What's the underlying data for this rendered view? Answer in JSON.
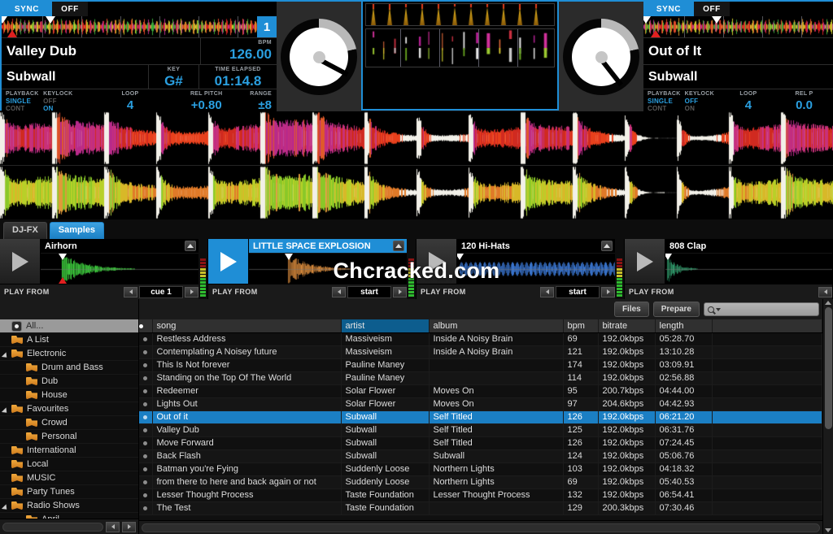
{
  "decks": [
    {
      "id": "deck-1",
      "number": "1",
      "sync_label": "SYNC",
      "off_label": "OFF",
      "title": "Valley Dub",
      "artist": "Subwall",
      "bpm_label": "BPM",
      "bpm_value": "126.00",
      "key_label": "KEY",
      "key_value": "G#",
      "time_label": "TIME ELAPSED",
      "time_value": "01:14.8",
      "playback_label": "PLAYBACK",
      "playback_single": "SINGLE",
      "playback_cont": "CONT",
      "playback_active": "single",
      "keylock_label": "KEYLOCK",
      "keylock_off": "OFF",
      "keylock_on": "ON",
      "keylock_active": "on",
      "loop_label": "LOOP",
      "loop_value": "4",
      "pitch_label": "REL PITCH",
      "pitch_value": "+0.80",
      "range_label": "RANGE",
      "range_value": "±8",
      "jog_angle_deg": 28
    },
    {
      "id": "deck-2",
      "number": "",
      "sync_label": "SYNC",
      "off_label": "OFF",
      "title": "Out of It",
      "artist": "Subwall",
      "bpm_label": "",
      "bpm_value": "",
      "key_label": "",
      "key_value": "",
      "time_label": "",
      "time_value": "",
      "playback_label": "PLAYBACK",
      "playback_single": "SINGLE",
      "playback_cont": "CONT",
      "playback_active": "single",
      "keylock_label": "KEYLOCK",
      "keylock_off": "OFF",
      "keylock_on": "ON",
      "keylock_active": "off",
      "loop_label": "LOOP",
      "loop_value": "4",
      "pitch_label": "REL P",
      "pitch_value": "0.0",
      "range_label": "",
      "range_value": "",
      "jog_angle_deg": 52
    }
  ],
  "fx": {
    "tabs": [
      {
        "label": "DJ-FX",
        "active": false
      },
      {
        "label": "Samples",
        "active": true
      }
    ]
  },
  "samples": [
    {
      "name": "Airhorn",
      "playing": false,
      "selected": false,
      "play_from_label": "PLAY FROM",
      "cue": "cue 1",
      "wave_color": "#3fd43f"
    },
    {
      "name": "LITTLE SPACE EXPLOSION",
      "playing": true,
      "selected": true,
      "play_from_label": "PLAY FROM",
      "cue": "start",
      "wave_color": "#d88a3c"
    },
    {
      "name": "120 Hi-Hats",
      "playing": false,
      "selected": false,
      "play_from_label": "PLAY FROM",
      "cue": "start",
      "wave_color": "#3c7ad8"
    },
    {
      "name": "808 Clap",
      "playing": false,
      "selected": false,
      "play_from_label": "PLAY FROM",
      "cue": "",
      "wave_color": "#2f9a6a"
    }
  ],
  "sidebar": {
    "items": [
      {
        "label": "All...",
        "icon": "all-icon",
        "level": 0,
        "selected": true,
        "expandable": false,
        "expanded": false
      },
      {
        "label": "A List",
        "icon": "folder-icon",
        "level": 0,
        "selected": false,
        "expandable": false,
        "expanded": false
      },
      {
        "label": "Electronic",
        "icon": "folder-icon",
        "level": 0,
        "selected": false,
        "expandable": true,
        "expanded": true
      },
      {
        "label": "Drum and Bass",
        "icon": "folder-icon",
        "level": 1,
        "selected": false,
        "expandable": false,
        "expanded": false
      },
      {
        "label": "Dub",
        "icon": "folder-icon",
        "level": 1,
        "selected": false,
        "expandable": false,
        "expanded": false
      },
      {
        "label": "House",
        "icon": "folder-icon",
        "level": 1,
        "selected": false,
        "expandable": false,
        "expanded": false
      },
      {
        "label": "Favourites",
        "icon": "folder-icon",
        "level": 0,
        "selected": false,
        "expandable": true,
        "expanded": true
      },
      {
        "label": "Crowd",
        "icon": "folder-icon",
        "level": 1,
        "selected": false,
        "expandable": false,
        "expanded": false
      },
      {
        "label": "Personal",
        "icon": "folder-icon",
        "level": 1,
        "selected": false,
        "expandable": false,
        "expanded": false
      },
      {
        "label": "International",
        "icon": "folder-icon",
        "level": 0,
        "selected": false,
        "expandable": false,
        "expanded": false
      },
      {
        "label": "Local",
        "icon": "folder-icon",
        "level": 0,
        "selected": false,
        "expandable": false,
        "expanded": false
      },
      {
        "label": "MUSIC",
        "icon": "folder-icon",
        "level": 0,
        "selected": false,
        "expandable": false,
        "expanded": false
      },
      {
        "label": "Party Tunes",
        "icon": "folder-icon",
        "level": 0,
        "selected": false,
        "expandable": false,
        "expanded": false
      },
      {
        "label": "Radio Shows",
        "icon": "folder-icon",
        "level": 0,
        "selected": false,
        "expandable": true,
        "expanded": true
      },
      {
        "label": "April",
        "icon": "folder-icon",
        "level": 1,
        "selected": false,
        "expandable": false,
        "expanded": false
      }
    ]
  },
  "toolbar": {
    "files_label": "Files",
    "prepare_label": "Prepare",
    "search_value": "",
    "search_placeholder": ""
  },
  "table": {
    "columns": [
      {
        "key": "song",
        "label": "song",
        "sorted": false
      },
      {
        "key": "artist",
        "label": "artist",
        "sorted": true
      },
      {
        "key": "album",
        "label": "album",
        "sorted": false
      },
      {
        "key": "bpm",
        "label": "bpm",
        "sorted": false
      },
      {
        "key": "bitrate",
        "label": "bitrate",
        "sorted": false
      },
      {
        "key": "length",
        "label": "length",
        "sorted": false
      }
    ],
    "rows": [
      {
        "song": "Restless Address",
        "artist": "Massiveism",
        "album": "Inside A Noisy Brain",
        "bpm": "69",
        "bitrate": "192.0kbps",
        "length": "05:28.70",
        "selected": false
      },
      {
        "song": "Contemplating A Noisey future",
        "artist": "Massiveism",
        "album": "Inside A Noisy Brain",
        "bpm": "121",
        "bitrate": "192.0kbps",
        "length": "13:10.28",
        "selected": false
      },
      {
        "song": "This Is Not forever",
        "artist": "Pauline Maney",
        "album": "",
        "bpm": "174",
        "bitrate": "192.0kbps",
        "length": "03:09.91",
        "selected": false
      },
      {
        "song": "Standing on the Top Of The World",
        "artist": "Pauline Maney",
        "album": "",
        "bpm": "114",
        "bitrate": "192.0kbps",
        "length": "02:56.88",
        "selected": false
      },
      {
        "song": "Redeemer",
        "artist": "Solar Flower",
        "album": "Moves On",
        "bpm": "95",
        "bitrate": "200.7kbps",
        "length": "04:44.00",
        "selected": false
      },
      {
        "song": "Lights Out",
        "artist": "Solar Flower",
        "album": "Moves On",
        "bpm": "97",
        "bitrate": "204.6kbps",
        "length": "04:42.93",
        "selected": false
      },
      {
        "song": "Out of it",
        "artist": "Subwall",
        "album": "Self Titled",
        "bpm": "126",
        "bitrate": "192.0kbps",
        "length": "06:21.20",
        "selected": true
      },
      {
        "song": "Valley Dub",
        "artist": "Subwall",
        "album": "Self Titled",
        "bpm": "125",
        "bitrate": "192.0kbps",
        "length": "06:31.76",
        "selected": false
      },
      {
        "song": "Move Forward",
        "artist": "Subwall",
        "album": "Self Titled",
        "bpm": "126",
        "bitrate": "192.0kbps",
        "length": "07:24.45",
        "selected": false
      },
      {
        "song": "Back Flash",
        "artist": "Subwall",
        "album": "Subwall",
        "bpm": "124",
        "bitrate": "192.0kbps",
        "length": "05:06.76",
        "selected": false
      },
      {
        "song": "Batman you're Fying",
        "artist": "Suddenly Loose",
        "album": "Northern Lights",
        "bpm": "103",
        "bitrate": "192.0kbps",
        "length": "04:18.32",
        "selected": false
      },
      {
        "song": "from there to here and back again or not",
        "artist": "Suddenly Loose",
        "album": "Northern Lights",
        "bpm": "69",
        "bitrate": "192.0kbps",
        "length": "05:40.53",
        "selected": false
      },
      {
        "song": "Lesser Thought Process",
        "artist": "Taste Foundation",
        "album": "Lesser Thought Process",
        "bpm": "132",
        "bitrate": "192.0kbps",
        "length": "06:54.41",
        "selected": false
      },
      {
        "song": "The Test",
        "artist": "Taste Foundation",
        "album": "",
        "bpm": "129",
        "bitrate": "200.3kbps",
        "length": "07:30.46",
        "selected": false
      }
    ]
  },
  "watermark": {
    "text": "Chcracked.com"
  }
}
